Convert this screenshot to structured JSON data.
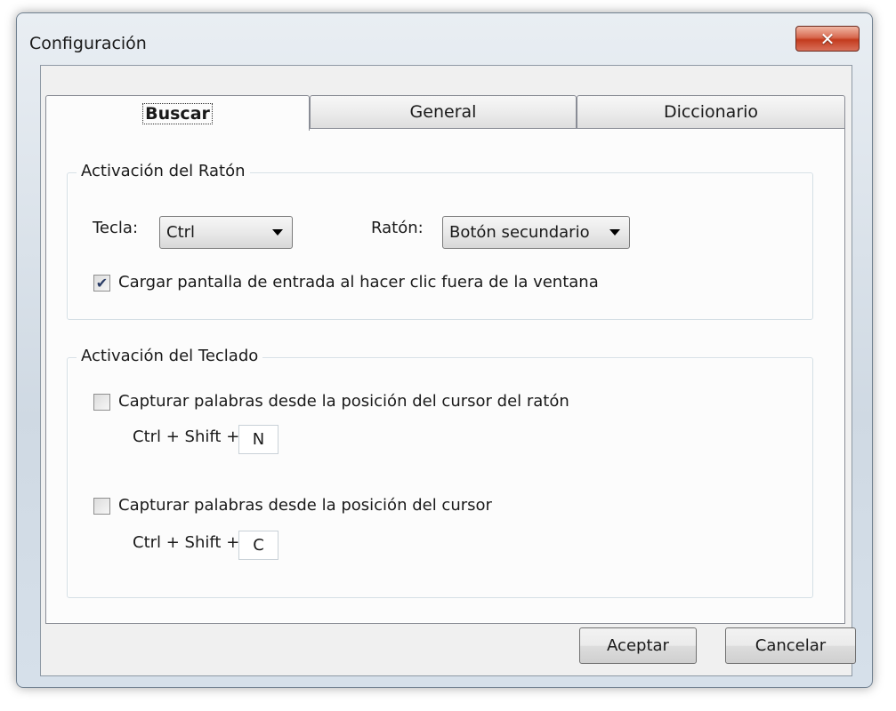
{
  "window": {
    "title": "Configuración",
    "close_symbol": "✕"
  },
  "tabs": [
    {
      "label": "Buscar",
      "active": true
    },
    {
      "label": "General",
      "active": false
    },
    {
      "label": "Diccionario",
      "active": false
    }
  ],
  "mouse_group": {
    "legend": "Activación del Ratón",
    "key_label": "Tecla:",
    "key_value": "Ctrl",
    "mouse_label": "Ratón:",
    "mouse_value": "Botón secundario",
    "load_checkbox": {
      "checked": true,
      "label": "Cargar pantalla de entrada al hacer clic fuera de la ventana"
    }
  },
  "keyboard_group": {
    "legend": "Activación del Teclado",
    "option1": {
      "checked": false,
      "label": "Capturar palabras desde la posición del cursor del ratón",
      "shortcut_prefix": "Ctrl + Shift +",
      "shortcut_key": "N"
    },
    "option2": {
      "checked": false,
      "label": "Capturar palabras desde la posición del cursor",
      "shortcut_prefix": "Ctrl + Shift +",
      "shortcut_key": "C"
    }
  },
  "buttons": {
    "ok": "Aceptar",
    "cancel": "Cancelar"
  },
  "icons": {
    "close": "close-icon",
    "dropdown": "chevron-down-icon",
    "check": "checkmark-icon"
  },
  "colors": {
    "close_button": "#c33b1e",
    "check_mark": "#2a3c66"
  }
}
